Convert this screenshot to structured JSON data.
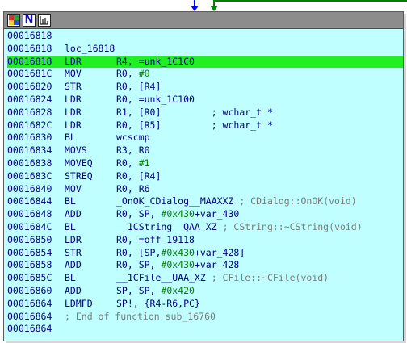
{
  "colors": {
    "node_background": "#c0ffff",
    "highlight_line": "#22ee22",
    "titlebar": "#8c8c8c",
    "arrow_blue": "#0000ff",
    "arrow_green": "#008000",
    "text_code": "#000080",
    "text_immediate": "#008000",
    "text_comment": "#7a7a7a"
  },
  "titlebar": {
    "icons": [
      "color-palette-icon",
      "rename-icon",
      "graph-overview-icon"
    ],
    "rename_glyph": "N"
  },
  "listing": [
    {
      "addr": "00016818",
      "kind": "blank"
    },
    {
      "addr": "00016818",
      "kind": "label",
      "label": "loc_16818"
    },
    {
      "addr": "00016818",
      "kind": "insn",
      "mnemonic": "LDR",
      "operands": [
        {
          "t": "R4, ="
        },
        {
          "t": "unk_1C1C0",
          "c": "sym"
        }
      ],
      "highlight": true
    },
    {
      "addr": "0001681C",
      "kind": "insn",
      "mnemonic": "MOV",
      "operands": [
        {
          "t": "R0, "
        },
        {
          "t": "#0",
          "c": "imm"
        }
      ]
    },
    {
      "addr": "00016820",
      "kind": "insn",
      "mnemonic": "STR",
      "operands": [
        {
          "t": "R0, [R4]"
        }
      ]
    },
    {
      "addr": "00016824",
      "kind": "insn",
      "mnemonic": "LDR",
      "operands": [
        {
          "t": "R0, =unk_1C100"
        }
      ]
    },
    {
      "addr": "00016828",
      "kind": "insn",
      "mnemonic": "LDR",
      "operands": [
        {
          "t": "R1, [R0]         "
        },
        {
          "t": "; wchar_t *",
          "c": "sym"
        }
      ]
    },
    {
      "addr": "0001682C",
      "kind": "insn",
      "mnemonic": "LDR",
      "operands": [
        {
          "t": "R0, [R5]         "
        },
        {
          "t": "; wchar_t *",
          "c": "sym"
        }
      ]
    },
    {
      "addr": "00016830",
      "kind": "insn",
      "mnemonic": "BL",
      "operands": [
        {
          "t": "wcscmp"
        }
      ]
    },
    {
      "addr": "00016834",
      "kind": "insn",
      "mnemonic": "MOVS",
      "operands": [
        {
          "t": "R3, R0"
        }
      ]
    },
    {
      "addr": "00016838",
      "kind": "insn",
      "mnemonic": "MOVEQ",
      "operands": [
        {
          "t": "R0, "
        },
        {
          "t": "#1",
          "c": "imm"
        }
      ]
    },
    {
      "addr": "0001683C",
      "kind": "insn",
      "mnemonic": "STREQ",
      "operands": [
        {
          "t": "R0, [R4]"
        }
      ]
    },
    {
      "addr": "00016840",
      "kind": "insn",
      "mnemonic": "MOV",
      "operands": [
        {
          "t": "R0, R6"
        }
      ]
    },
    {
      "addr": "00016844",
      "kind": "insn",
      "mnemonic": "BL",
      "operands": [
        {
          "t": "_OnOK_CDialog__MAAXXZ "
        },
        {
          "t": "; CDialog::OnOK(void)",
          "c": "cmt"
        }
      ]
    },
    {
      "addr": "00016848",
      "kind": "insn",
      "mnemonic": "ADD",
      "operands": [
        {
          "t": "R0, SP, "
        },
        {
          "t": "#0x430",
          "c": "imm"
        },
        {
          "t": "+var_430"
        }
      ]
    },
    {
      "addr": "0001684C",
      "kind": "insn",
      "mnemonic": "BL",
      "operands": [
        {
          "t": "__1CString__QAA_XZ "
        },
        {
          "t": "; CString::~CString(void)",
          "c": "cmt"
        }
      ]
    },
    {
      "addr": "00016850",
      "kind": "insn",
      "mnemonic": "LDR",
      "operands": [
        {
          "t": "R0, =off_19118"
        }
      ]
    },
    {
      "addr": "00016854",
      "kind": "insn",
      "mnemonic": "STR",
      "operands": [
        {
          "t": "R0, [SP,"
        },
        {
          "t": "#0x430",
          "c": "imm"
        },
        {
          "t": "+var_428]"
        }
      ]
    },
    {
      "addr": "00016858",
      "kind": "insn",
      "mnemonic": "ADD",
      "operands": [
        {
          "t": "R0, SP, "
        },
        {
          "t": "#0x430",
          "c": "imm"
        },
        {
          "t": "+var_428"
        }
      ]
    },
    {
      "addr": "0001685C",
      "kind": "insn",
      "mnemonic": "BL",
      "operands": [
        {
          "t": "__1CFile__UAA_XZ "
        },
        {
          "t": "; CFile::~CFile(void)",
          "c": "cmt"
        }
      ]
    },
    {
      "addr": "00016860",
      "kind": "insn",
      "mnemonic": "ADD",
      "operands": [
        {
          "t": "SP, SP, "
        },
        {
          "t": "#0x420",
          "c": "imm"
        }
      ]
    },
    {
      "addr": "00016864",
      "kind": "insn",
      "mnemonic": "LDMFD",
      "operands": [
        {
          "t": "SP!, {R4-R6,PC}"
        }
      ]
    },
    {
      "addr": "00016864",
      "kind": "comment",
      "comment": "; End of function sub_16760"
    },
    {
      "addr": "00016864",
      "kind": "blank"
    }
  ]
}
